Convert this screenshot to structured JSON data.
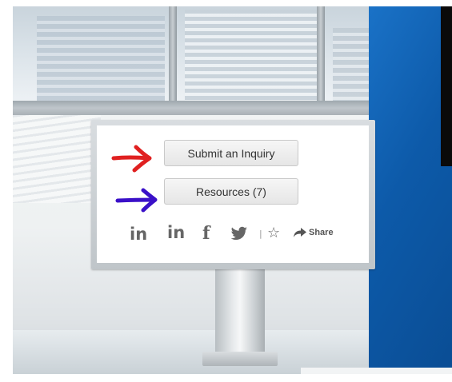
{
  "kiosk": {
    "submit_button": "Submit an Inquiry",
    "resources_button": "Resources (7)",
    "share_label": "Share"
  },
  "social": {
    "icons": [
      "linkedin-icon",
      "linkedin-icon",
      "facebook-icon",
      "twitter-icon",
      "star-icon",
      "share-arrow-icon"
    ],
    "separator": "|"
  },
  "annotations": {
    "arrow_1_color": "#e02020",
    "arrow_2_color": "#3a10c8"
  },
  "colors": {
    "background_blue": "#0d5aa9",
    "button_text": "#333333",
    "icon_gray": "#666666"
  }
}
